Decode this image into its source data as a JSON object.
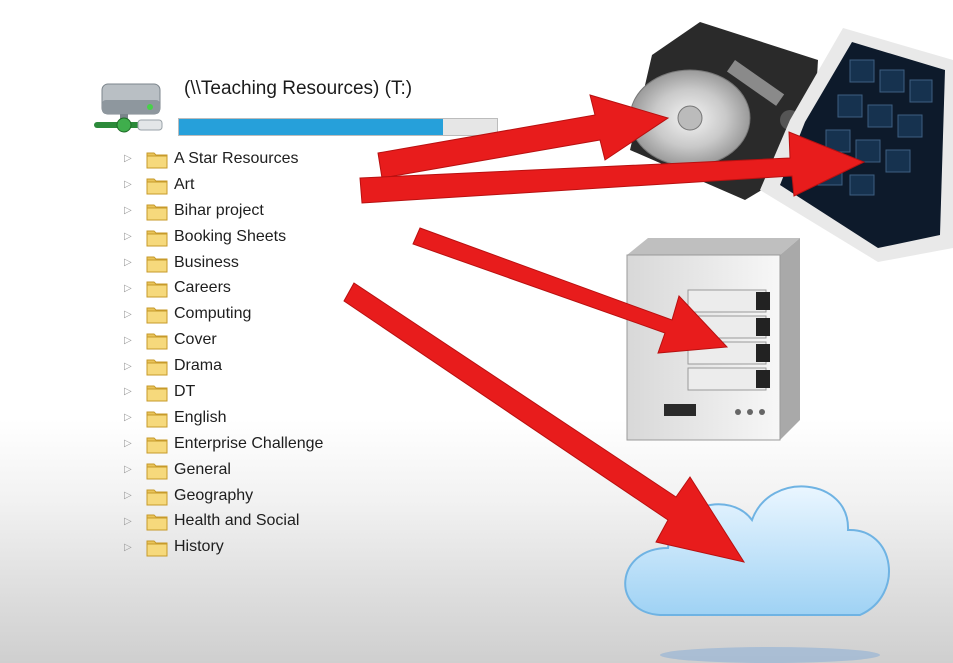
{
  "drive": {
    "title": "(\\\\Teaching Resources) (T:)",
    "usage_fraction": 0.83,
    "icon": "network-drive-icon"
  },
  "folders": [
    {
      "label": "A Star Resources"
    },
    {
      "label": "Art"
    },
    {
      "label": "Bihar project"
    },
    {
      "label": "Booking Sheets"
    },
    {
      "label": "Business"
    },
    {
      "label": "Careers"
    },
    {
      "label": "Computing"
    },
    {
      "label": "Cover"
    },
    {
      "label": "Drama"
    },
    {
      "label": "DT"
    },
    {
      "label": "English"
    },
    {
      "label": "Enterprise Challenge"
    },
    {
      "label": "General"
    },
    {
      "label": "Geography"
    },
    {
      "label": "Health and Social"
    },
    {
      "label": "History"
    }
  ],
  "icons": {
    "expander": "chevron-right-icon",
    "folder": "folder-icon",
    "targets": [
      "hard-disk-icon",
      "ssd-icon",
      "nas-server-icon",
      "cloud-icon"
    ]
  },
  "colors": {
    "arrow": "#e81c1c",
    "bar_fill": "#26a0da",
    "folder": "#e9c45a"
  }
}
